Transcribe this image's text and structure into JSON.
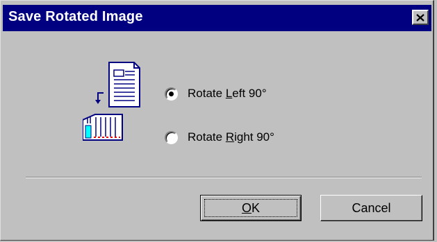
{
  "window": {
    "title": "Save Rotated Image",
    "close_icon": "close-x-icon"
  },
  "illustration": {
    "icon": "rotate-page-illustration-icon"
  },
  "options": [
    {
      "prefix": "Rotate ",
      "accel": "L",
      "suffix": "eft 90°",
      "selected": true
    },
    {
      "prefix": "Rotate ",
      "accel": "R",
      "suffix": "ight 90°",
      "selected": false
    }
  ],
  "buttons": {
    "ok_prefix": "",
    "ok_accel": "O",
    "ok_suffix": "K",
    "cancel_label": "Cancel"
  },
  "colors": {
    "titlebar": "#000080",
    "face": "#c0c0c0",
    "icon_accent": "#00ffff",
    "icon_marks": "#ff0000"
  }
}
